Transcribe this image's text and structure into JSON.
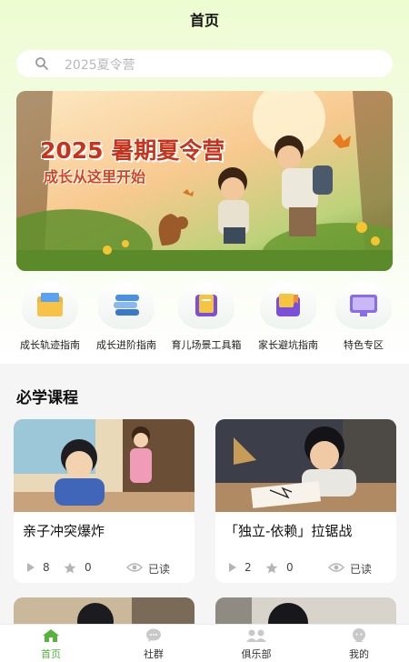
{
  "header": {
    "title": "首页"
  },
  "search": {
    "placeholder": "2025夏令营",
    "icon": "search-icon"
  },
  "banner": {
    "title": "2025 暑期夏令营",
    "subtitle": "成长从这里开始"
  },
  "shortcuts": [
    {
      "label": "成长轨迹指南",
      "icon": "folder-icon"
    },
    {
      "label": "成长进阶指南",
      "icon": "books-stack-icon"
    },
    {
      "label": "育儿场景工具箱",
      "icon": "notebook-icon"
    },
    {
      "label": "家长避坑指南",
      "icon": "folder-bookmark-icon"
    },
    {
      "label": "特色专区",
      "icon": "monitor-icon"
    }
  ],
  "courses": {
    "section_title": "必学课程",
    "items": [
      {
        "title": "亲子冲突爆炸",
        "plays": "8",
        "stars": "0",
        "status": "已读"
      },
      {
        "title": "「独立-依赖」拉锯战",
        "plays": "2",
        "stars": "0",
        "status": "已读"
      }
    ]
  },
  "tabbar": [
    {
      "label": "首页",
      "icon": "home-icon",
      "active": true
    },
    {
      "label": "社群",
      "icon": "chat-bubble-icon",
      "active": false
    },
    {
      "label": "俱乐部",
      "icon": "people-icon",
      "active": false
    },
    {
      "label": "我的",
      "icon": "profile-icon",
      "active": false
    }
  ],
  "colors": {
    "accent": "#57b33c",
    "banner_title": "#c8331c",
    "page_bg": "#f4f5f4"
  }
}
